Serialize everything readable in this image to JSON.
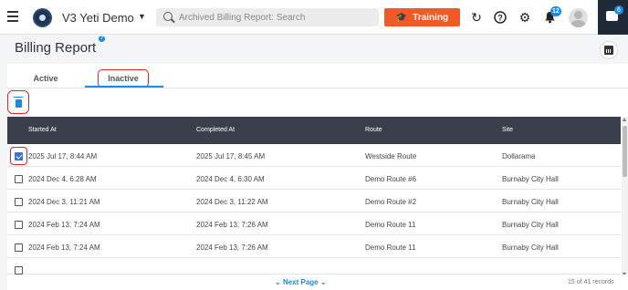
{
  "header": {
    "app_title": "V3 Yeti Demo",
    "search_placeholder": "Archived Billing Report: Search",
    "training_label": "Training",
    "notification_count": "12",
    "chat_count": "6",
    "accent_color": "#f05a28"
  },
  "page": {
    "title": "Billing Report",
    "help_glyph": "?"
  },
  "tabs": [
    {
      "label": "Active",
      "selected": false
    },
    {
      "label": "Inactive",
      "selected": true
    }
  ],
  "table": {
    "columns": [
      "Started At",
      "Completed At",
      "Route",
      "Site"
    ],
    "rows": [
      {
        "checked": true,
        "started": "2025 Jul 17, 8:44 AM",
        "completed": "2025 Jul 17, 8:45 AM",
        "route": "Westside Route",
        "site": "Dollarama"
      },
      {
        "checked": false,
        "started": "2024 Dec 4, 6:28 AM",
        "completed": "2024 Dec 4, 6:30 AM",
        "route": "Demo Route #6",
        "site": "Burnaby City Hall"
      },
      {
        "checked": false,
        "started": "2024 Dec 3, 11:21 AM",
        "completed": "2024 Dec 3, 11:22 AM",
        "route": "Demo Route #2",
        "site": "Burnaby City Hall"
      },
      {
        "checked": false,
        "started": "2024 Feb 13, 7:24 AM",
        "completed": "2024 Feb 13, 7:26 AM",
        "route": "Demo Route 11",
        "site": "Burnaby City Hall"
      },
      {
        "checked": false,
        "started": "2024 Feb 13, 7:24 AM",
        "completed": "2024 Feb 13, 7:26 AM",
        "route": "Demo Route 11",
        "site": "Burnaby City Hall"
      }
    ]
  },
  "footer": {
    "next_page_label": "Next Page",
    "records_label": "15 of 41 records"
  }
}
